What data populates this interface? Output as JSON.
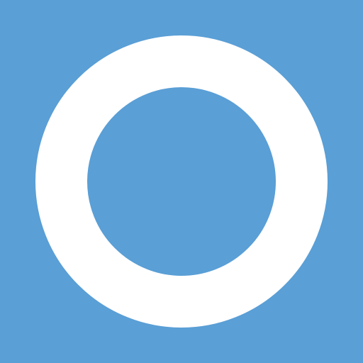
{
  "icon": {
    "name": "ring-icon",
    "shape": "circle-outline"
  },
  "colors": {
    "background": "#5a9fd6",
    "ring": "#ffffff"
  }
}
